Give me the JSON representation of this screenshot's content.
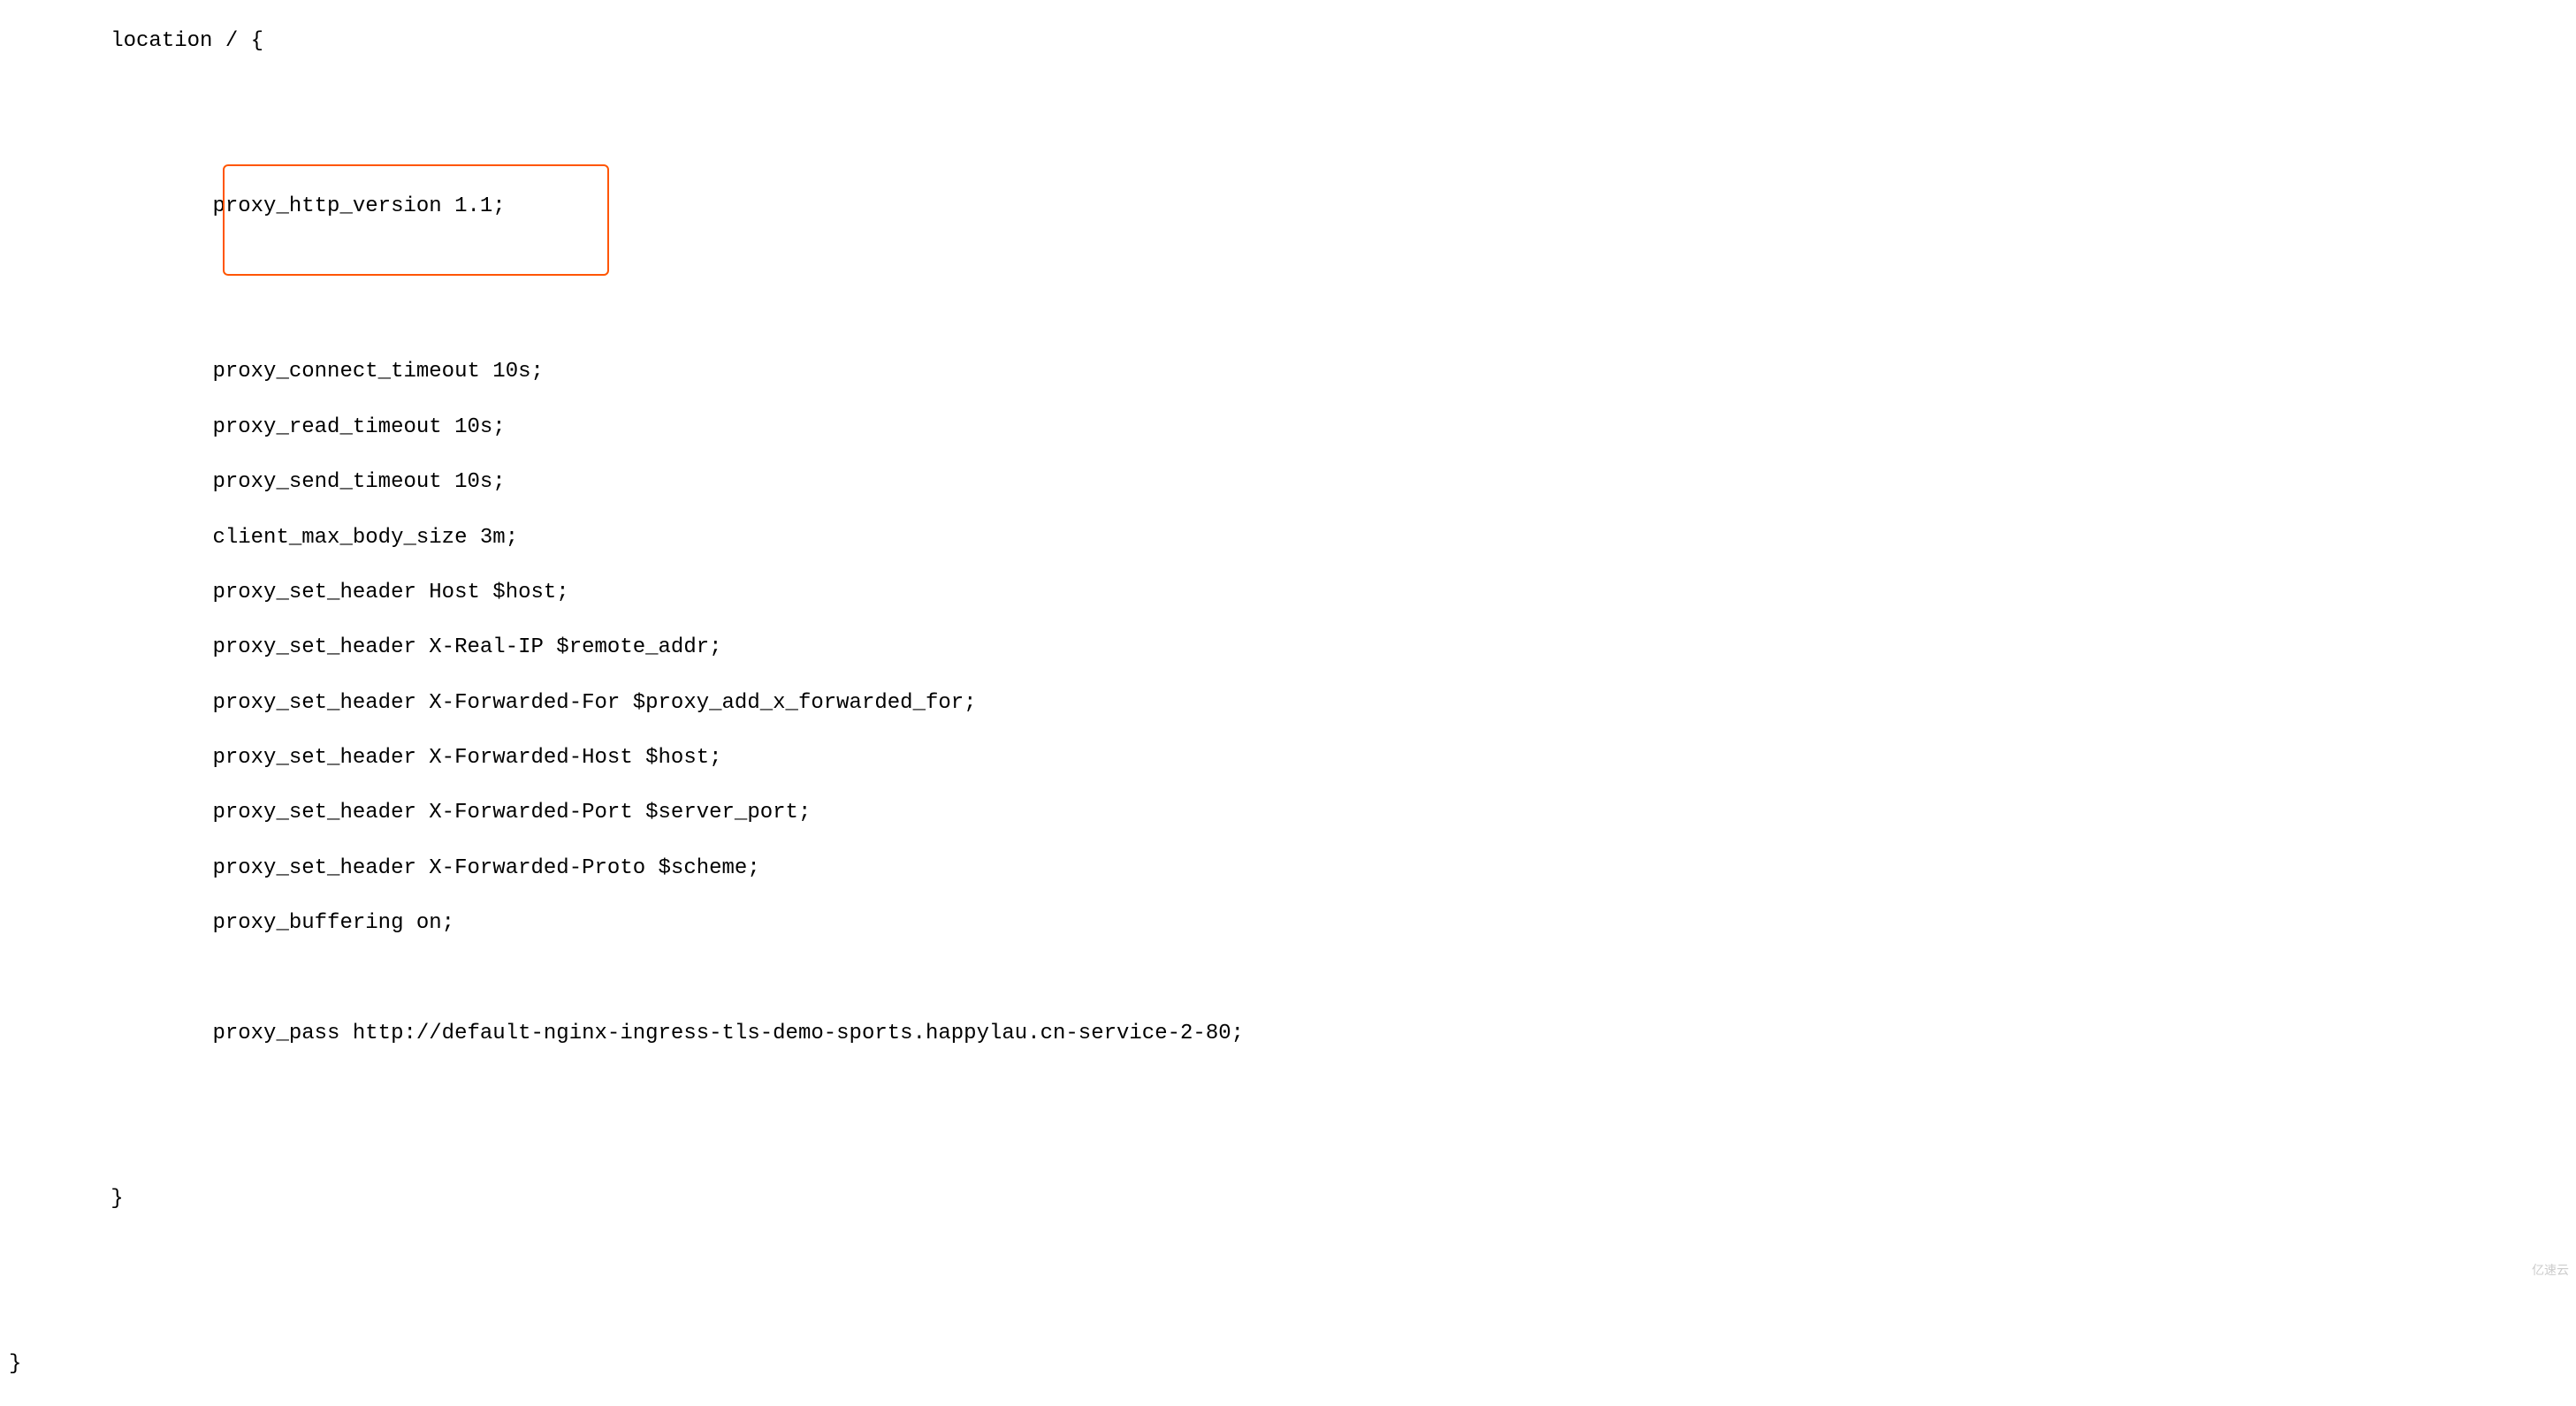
{
  "code": {
    "line1": "        location / {",
    "line2": "",
    "line3": "",
    "line4": "                proxy_http_version 1.1;",
    "line5": "",
    "line6": "",
    "line7": "                proxy_connect_timeout 10s;",
    "line8": "                proxy_read_timeout 10s;",
    "line9": "                proxy_send_timeout 10s;",
    "line10": "                client_max_body_size 3m;",
    "line11": "                proxy_set_header Host $host;",
    "line12": "                proxy_set_header X-Real-IP $remote_addr;",
    "line13": "                proxy_set_header X-Forwarded-For $proxy_add_x_forwarded_for;",
    "line14": "                proxy_set_header X-Forwarded-Host $host;",
    "line15": "                proxy_set_header X-Forwarded-Port $server_port;",
    "line16": "                proxy_set_header X-Forwarded-Proto $scheme;",
    "line17": "                proxy_buffering on;",
    "line18": "",
    "line19": "                proxy_pass http://default-nginx-ingress-tls-demo-sports.happylau.cn-service-2-80;",
    "line20": "",
    "line21": "",
    "line22": "        }",
    "line23": "",
    "line24": "",
    "line25": "}"
  },
  "watermark": "亿速云"
}
